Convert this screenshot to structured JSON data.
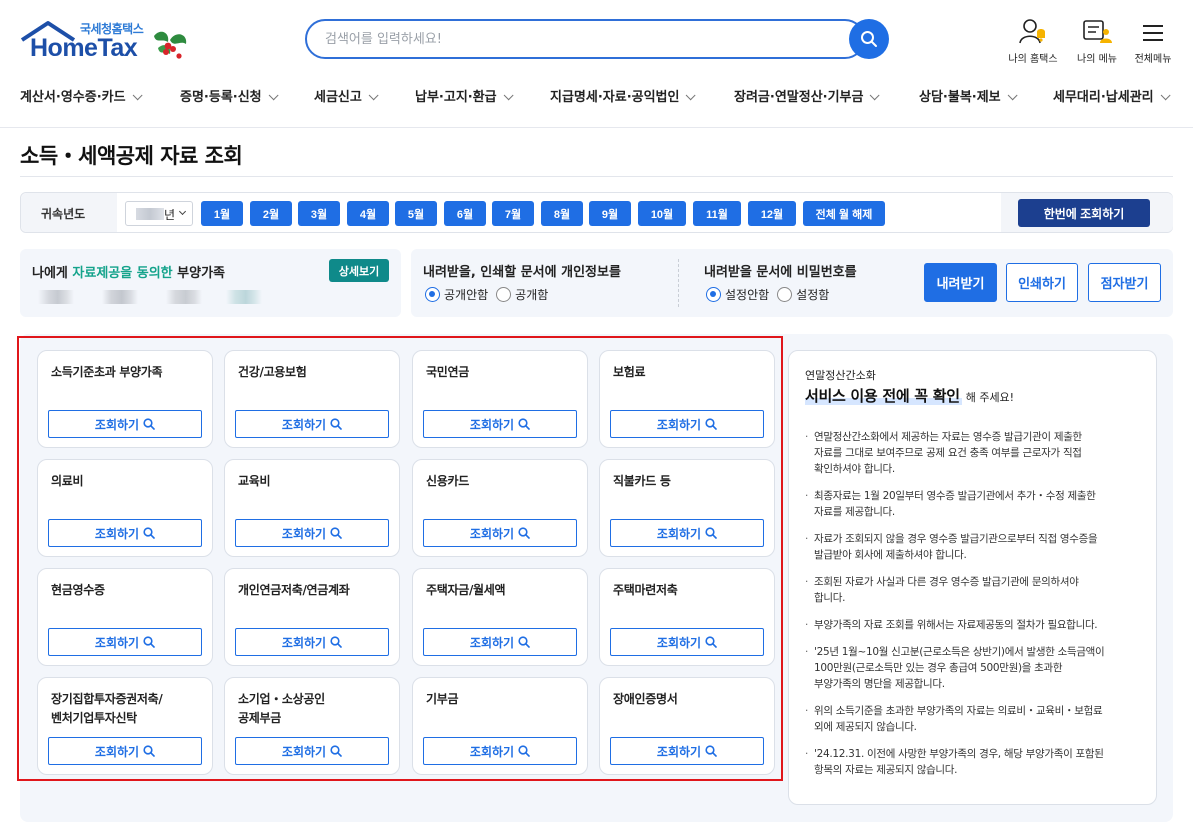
{
  "header": {
    "logo_sub": "국세청홈택스",
    "logo_main": "HomeTax",
    "search_placeholder": "검색어를 입력하세요!",
    "utils": [
      {
        "label": "나의 홈택스",
        "icon": "my-hometax-icon"
      },
      {
        "label": "나의 메뉴",
        "icon": "my-menu-icon"
      },
      {
        "label": "전체메뉴",
        "icon": "hamburger-menu-icon"
      }
    ],
    "nav": [
      "계산서·영수증·카드",
      "증명·등록·신청",
      "세금신고",
      "납부·고지·환급",
      "지급명세·자료·공익법인",
      "장려금·연말정산·기부금",
      "상담·불복·제보",
      "세무대리·납세관리"
    ]
  },
  "page_title": "소득・세액공제 자료 조회",
  "monthbar": {
    "year_label": "귀속년도",
    "year_suffix": "년",
    "months": [
      "1월",
      "2월",
      "3월",
      "4월",
      "5월",
      "6월",
      "7월",
      "8월",
      "9월",
      "10월",
      "11월",
      "12월",
      "전체 월 해제"
    ],
    "query_all": "한번에 조회하기"
  },
  "dependents": {
    "prefix": "나에게 ",
    "highlight": "자료제공을 동의한",
    "suffix": " 부양가족",
    "detail_button": "상세보기"
  },
  "options": {
    "personal_info_title": "내려받을, 인쇄할 문서에 개인정보를",
    "personal_info_options": [
      "공개안함",
      "공개함"
    ],
    "personal_info_selected": "공개안함",
    "password_title": "내려받을 문서에 비밀번호를",
    "password_options": [
      "설정안함",
      "설정함"
    ],
    "password_selected": "설정안함",
    "download": "내려받기",
    "print": "인쇄하기",
    "braille": "점자받기"
  },
  "cards": [
    {
      "title": "소득기준초과 부양가족",
      "button": "조회하기"
    },
    {
      "title": "건강/고용보험",
      "button": "조회하기"
    },
    {
      "title": "국민연금",
      "button": "조회하기"
    },
    {
      "title": "보험료",
      "button": "조회하기"
    },
    {
      "title": "의료비",
      "button": "조회하기"
    },
    {
      "title": "교육비",
      "button": "조회하기"
    },
    {
      "title": "신용카드",
      "button": "조회하기"
    },
    {
      "title": "직불카드 등",
      "button": "조회하기"
    },
    {
      "title": "현금영수증",
      "button": "조회하기"
    },
    {
      "title": "개인연금저축/연금계좌",
      "button": "조회하기"
    },
    {
      "title": "주택자금/월세액",
      "button": "조회하기"
    },
    {
      "title": "주택마련저축",
      "button": "조회하기"
    },
    {
      "title": "장기집합투자증권저축/\n벤처기업투자신탁",
      "button": "조회하기"
    },
    {
      "title": "소기업・소상공인\n공제부금",
      "button": "조회하기"
    },
    {
      "title": "기부금",
      "button": "조회하기"
    },
    {
      "title": "장애인증명서",
      "button": "조회하기"
    }
  ],
  "notice": {
    "sub": "연말정산간소화",
    "head": "서비스 이용 전에 꼭 확인",
    "head_tail": "해 주세요!",
    "items": [
      "연말정산간소화에서 제공하는 자료는 영수증 발급기관이 제출한\n자료를 그대로 보여주므로 공제 요건 충족 여부를 근로자가 직접\n확인하셔야 합니다.",
      "최종자료는 1월 20일부터 영수증 발급기관에서 추가・수정 제출한\n자료를 제공합니다.",
      "자료가 조회되지 않을 경우 영수증 발급기관으로부터 직접 영수증을\n발급받아 회사에 제출하셔야 합니다.",
      "조회된 자료가 사실과 다른 경우 영수증 발급기관에 문의하셔야\n합니다.",
      "부양가족의 자료 조회를 위해서는 자료제공동의 절차가 필요합니다.",
      "'25년 1월~10월 신고분(근로소득은 상반기)에서 발생한 소득금액이\n100만원(근로소득만 있는 경우 총급여 500만원)을 초과한\n부양가족의 명단을 제공합니다.",
      "위의 소득기준을 초과한 부양가족의 자료는 의료비・교육비・보험료\n외에 제공되지 않습니다.",
      "'24.12.31. 이전에 사망한 부양가족의 경우, 해당 부양가족이 포함된\n항목의 자료는 제공되지 않습니다."
    ]
  },
  "colors": {
    "primary": "#1f6ee4",
    "dark_button": "#1c3f8f",
    "teal_button": "#0f8a8a",
    "highlight_text": "#14a38b",
    "frame": "#e0161b",
    "panel_bg": "#f3f6fb"
  }
}
